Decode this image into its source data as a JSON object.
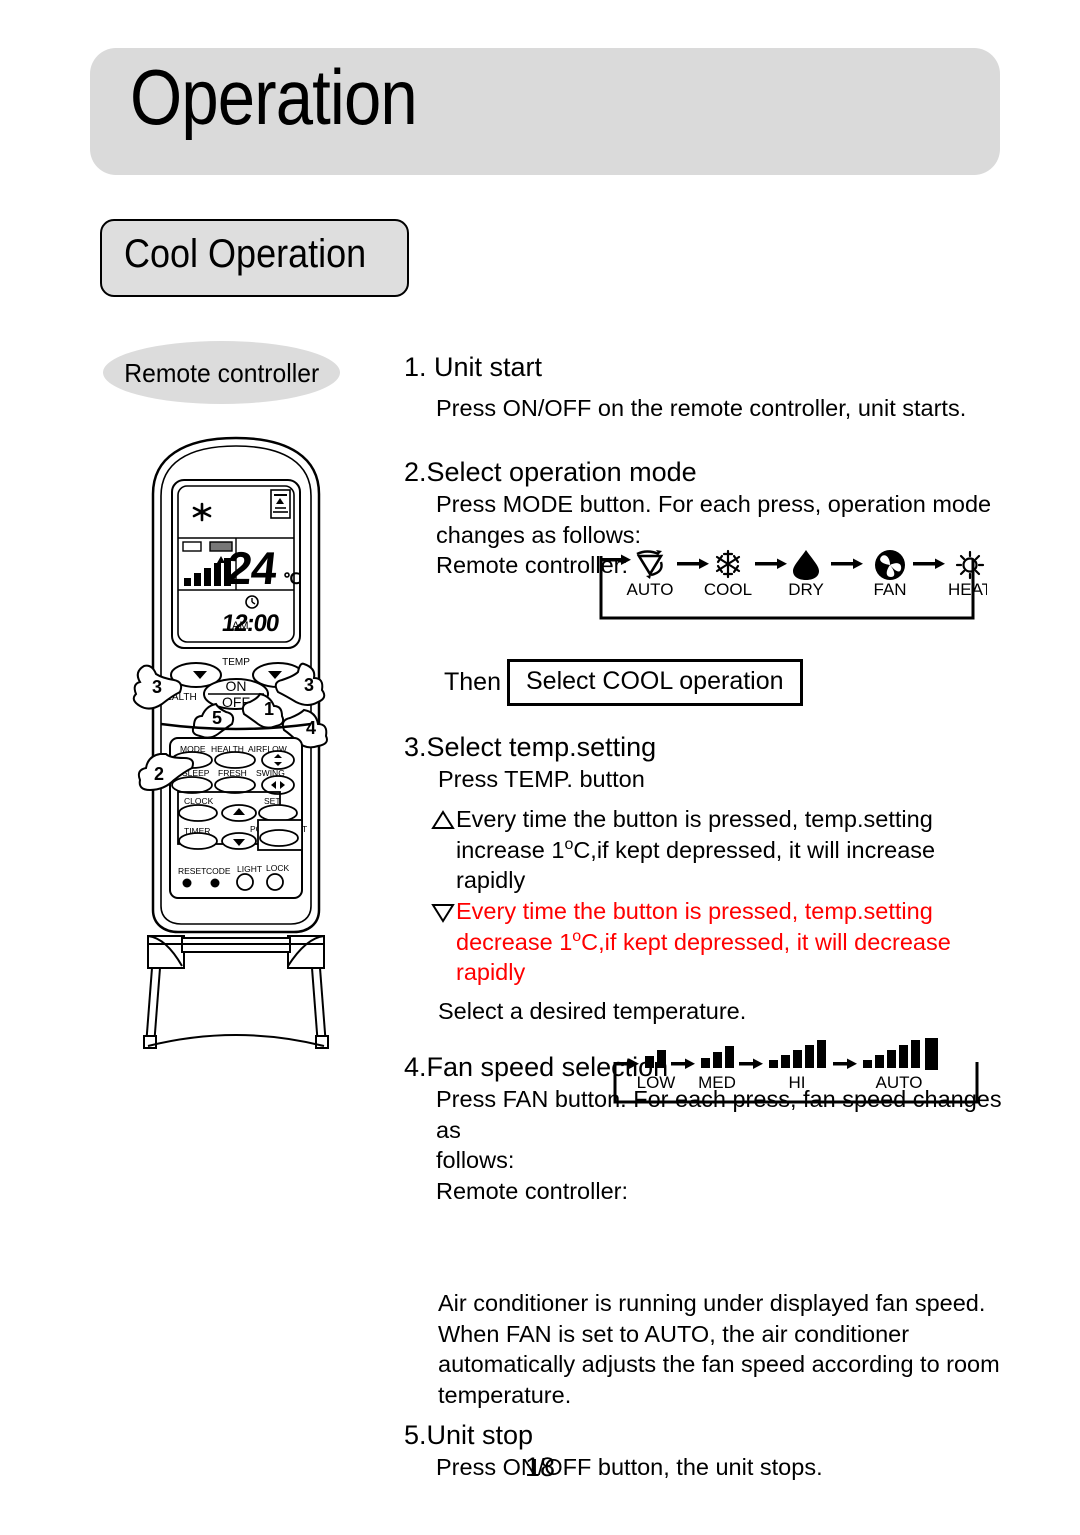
{
  "header": {
    "title": "Operation",
    "section_title": "Cool Operation"
  },
  "illustration": {
    "callout_label": "Remote controller",
    "lcd": {
      "mode_icon": "snowflake-icon",
      "signal_icon": "signal-icon",
      "temperature": "24",
      "temperature_unit": "°C",
      "clock_icon": "clock-icon",
      "meridiem": "AM",
      "time": "12:00",
      "fan_bars_icon": "fan-speed-bars-icon"
    },
    "top_labels": {
      "temp": "TEMP",
      "on": "ON",
      "off": "OFF",
      "health": "HEALTH"
    },
    "buttons": [
      "MODE",
      "HEALTH",
      "AIRFLOW",
      "SLEEP",
      "FRESH",
      "SWING",
      "CLOCK",
      "SET",
      "TIMER",
      "POWER/SOFT",
      "RESET",
      "CODE",
      "LIGHT",
      "LOCK"
    ],
    "callout_numbers": [
      "1",
      "2",
      "3",
      "3",
      "4",
      "5"
    ]
  },
  "steps": [
    {
      "heading": "1. Unit start",
      "body": "Press ON/OFF on the remote controller, unit starts."
    },
    {
      "heading": "2.Select operation mode",
      "body_line1": "Press MODE button. For each press, operation mode",
      "body_line2": "changes as follows:",
      "body_line3": "Remote controller:"
    },
    {
      "heading": "3.Select temp.setting",
      "body": "Press TEMP. button",
      "up_icon": "triangle-up-icon",
      "up_line1_a": "Every time the button is pressed, temp.setting",
      "up_line2_a": "increase 1",
      "up_line2_sup": "o",
      "up_line2_b": "C,if kept depressed, it will increase",
      "up_line3": "rapidly",
      "down_icon": "triangle-down-icon",
      "down_line1": "Every time the button is pressed, temp.setting",
      "down_line2_a": "decrease 1",
      "down_line2_sup": "o",
      "down_line2_b": "C,if kept depressed, it will decrease",
      "down_line3": "rapidly",
      "closing": "Select a desired temperature."
    },
    {
      "heading": "4.Fan speed selection",
      "body_line1": "Press FAN button. For each press, fan speed changes as",
      "body_line2": "follows:",
      "body_line3": "Remote controller:",
      "note_line1": "Air conditioner is running under displayed fan speed.",
      "note_line2": "When FAN is set to AUTO, the air conditioner",
      "note_line3": "automatically adjusts the fan speed according to room",
      "note_line4": "temperature."
    },
    {
      "heading": "5.Unit stop",
      "body": "Press ON/OFF button, the unit stops."
    }
  ],
  "then_row": {
    "label": "Then",
    "boxed_text": "Select COOL operation"
  },
  "mode_cycle": {
    "items": [
      {
        "label": "AUTO",
        "icon": "auto-mode-icon"
      },
      {
        "label": "COOL",
        "icon": "snowflake-icon"
      },
      {
        "label": "DRY",
        "icon": "water-drop-icon"
      },
      {
        "label": "FAN",
        "icon": "fan-blade-icon"
      },
      {
        "label": "HEAT",
        "icon": "sun-icon"
      }
    ]
  },
  "fan_cycle": {
    "items": [
      {
        "label": "LOW",
        "bars": 2,
        "icon": "fan-bars-low-icon"
      },
      {
        "label": "MED",
        "bars": 3,
        "icon": "fan-bars-med-icon"
      },
      {
        "label": "HI",
        "bars": 5,
        "icon": "fan-bars-hi-icon"
      },
      {
        "label": "AUTO",
        "bars": 5,
        "icon": "fan-bars-auto-icon",
        "vertical_text": "AUTO"
      }
    ]
  },
  "footer": {
    "page_number": "18"
  },
  "colors": {
    "header_gray": "#dadada",
    "chip_gray": "#dedede",
    "ellipse_gray": "#dcdcdc",
    "highlight_red": "#ff0000",
    "ink": "#000000"
  }
}
